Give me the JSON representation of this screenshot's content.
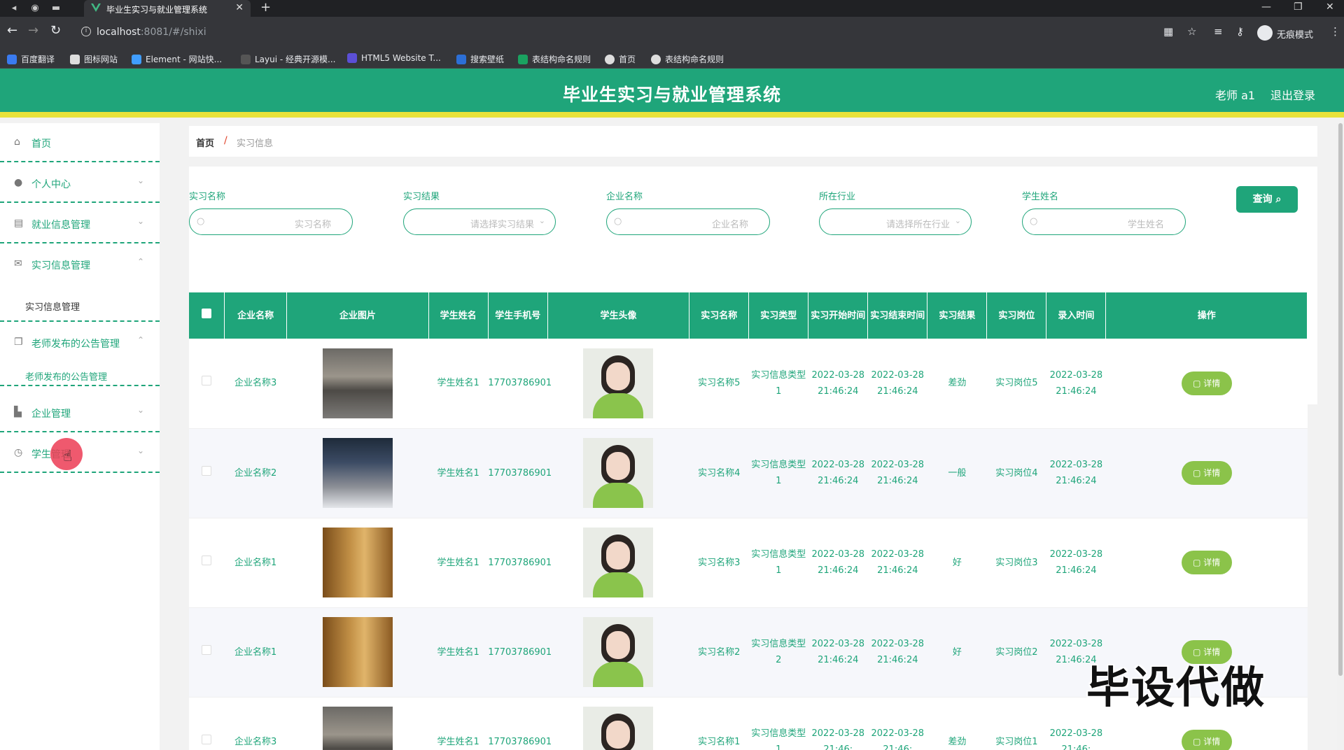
{
  "browser": {
    "tab_title": "毕业生实习与就业管理系统",
    "url_host": "localhost",
    "url_rest": ":8081/#/shixi",
    "incognito_label": "无痕模式",
    "bookmarks": [
      "百度翻译",
      "图标网站",
      "Element - 网站快...",
      "Layui - 经典开源模...",
      "HTML5 Website T...",
      "搜索壁纸",
      "表结构命名规则",
      "首页",
      "表结构命名规则"
    ]
  },
  "header": {
    "title": "毕业生实习与就业管理系统",
    "user": "老师 a1",
    "logout": "退出登录",
    "accent": "#1fa57a",
    "stripe": "#e8e23a"
  },
  "sidebar": {
    "items": [
      {
        "label": "首页",
        "icon": "home-icon"
      },
      {
        "label": "个人中心",
        "icon": "user-icon"
      },
      {
        "label": "就业信息管理",
        "icon": "clipboard-icon"
      },
      {
        "label": "实习信息管理",
        "icon": "mail-icon"
      },
      {
        "label": "老师发布的公告管理",
        "icon": "copy-icon"
      },
      {
        "label": "企业管理",
        "icon": "building-icon"
      },
      {
        "label": "学生管理",
        "icon": "clock-icon"
      }
    ],
    "sub_shixi": "实习信息管理",
    "sub_notice": "老师发布的公告管理"
  },
  "breadcrumb": {
    "home": "首页",
    "sep": "/",
    "current": "实习信息"
  },
  "filters": [
    {
      "label": "实习名称",
      "placeholder": "实习名称",
      "type": "input"
    },
    {
      "label": "实习结果",
      "placeholder": "请选择实习结果",
      "type": "select"
    },
    {
      "label": "企业名称",
      "placeholder": "企业名称",
      "type": "input"
    },
    {
      "label": "所在行业",
      "placeholder": "请选择所在行业",
      "type": "select"
    },
    {
      "label": "学生姓名",
      "placeholder": "学生姓名",
      "type": "input"
    }
  ],
  "search_button": "查询",
  "table": {
    "headers": [
      "企业名称",
      "企业图片",
      "学生姓名",
      "学生手机号",
      "学生头像",
      "实习名称",
      "实习类型",
      "实习开始时间",
      "实习结束时间",
      "实习结果",
      "实习岗位",
      "录入时间",
      "操作"
    ],
    "rows": [
      {
        "company": "企业名称3",
        "img": "office1",
        "student": "学生姓名1",
        "phone": "17703786901",
        "name": "实习名称5",
        "type": "实习信息类型1",
        "start": "2022-03-28 21:46:24",
        "end": "2022-03-28 21:46:24",
        "result": "差劲",
        "post": "实习岗位5",
        "created": "2022-03-28 21:46:24",
        "action": "详情"
      },
      {
        "company": "企业名称2",
        "img": "office2",
        "student": "学生姓名1",
        "phone": "17703786901",
        "name": "实习名称4",
        "type": "实习信息类型1",
        "start": "2022-03-28 21:46:24",
        "end": "2022-03-28 21:46:24",
        "result": "一般",
        "post": "实习岗位4",
        "created": "2022-03-28 21:46:24",
        "action": "详情"
      },
      {
        "company": "企业名称1",
        "img": "office3",
        "student": "学生姓名1",
        "phone": "17703786901",
        "name": "实习名称3",
        "type": "实习信息类型1",
        "start": "2022-03-28 21:46:24",
        "end": "2022-03-28 21:46:24",
        "result": "好",
        "post": "实习岗位3",
        "created": "2022-03-28 21:46:24",
        "action": "详情"
      },
      {
        "company": "企业名称1",
        "img": "office3",
        "student": "学生姓名1",
        "phone": "17703786901",
        "name": "实习名称2",
        "type": "实习信息类型2",
        "start": "2022-03-28 21:46:24",
        "end": "2022-03-28 21:46:24",
        "result": "好",
        "post": "实习岗位2",
        "created": "2022-03-28 21:46:24",
        "action": "详情"
      },
      {
        "company": "企业名称3",
        "img": "office1",
        "student": "学生姓名1",
        "phone": "17703786901",
        "name": "实习名称1",
        "type": "实习信息类型1",
        "start": "2022-03-28 21:46:",
        "end": "2022-03-28 21:46:",
        "result": "差劲",
        "post": "实习岗位1",
        "created": "2022-03-28 21:46:",
        "action": "详情"
      }
    ]
  },
  "watermark": "毕设代做"
}
